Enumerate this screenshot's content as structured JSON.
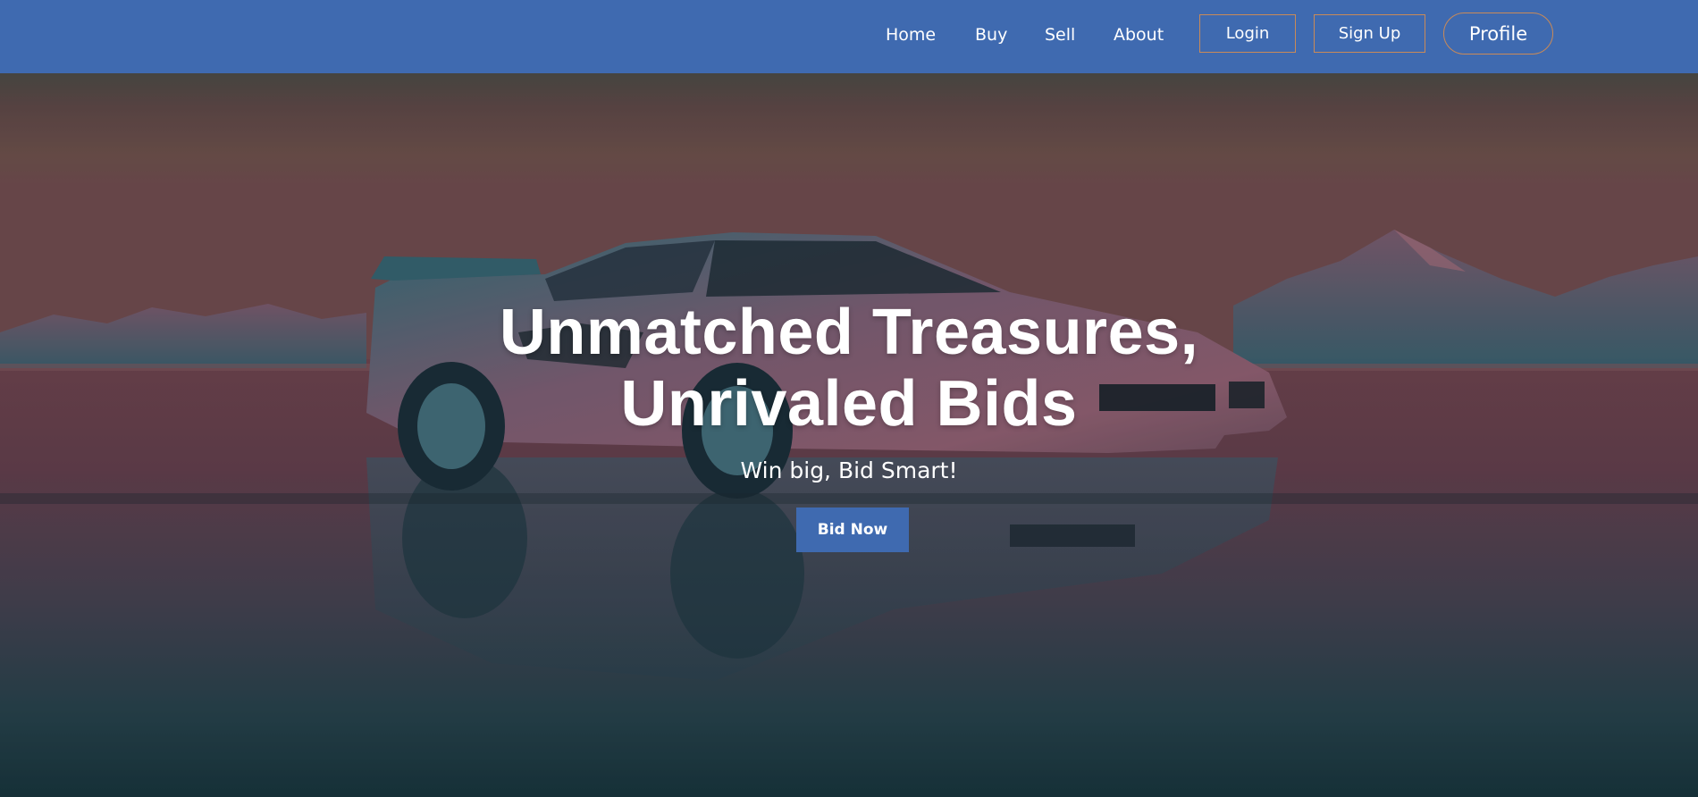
{
  "navbar": {
    "links": [
      {
        "label": "Home"
      },
      {
        "label": "Buy"
      },
      {
        "label": "Sell"
      },
      {
        "label": "About"
      }
    ],
    "login_label": "Login",
    "signup_label": "Sign Up",
    "profile_label": "Profile"
  },
  "hero": {
    "title_line1": "Unmatched Treasures,",
    "title_line2": "Unrivaled Bids",
    "subtitle": "Win big, Bid Smart!",
    "cta_label": "Bid Now",
    "background_icon": "sports-car-on-salt-flat-image"
  },
  "colors": {
    "navbar_bg": "#3f6ab0",
    "button_bg": "#3f6ab0",
    "button_border": "#c98a58",
    "text": "#ffffff"
  }
}
